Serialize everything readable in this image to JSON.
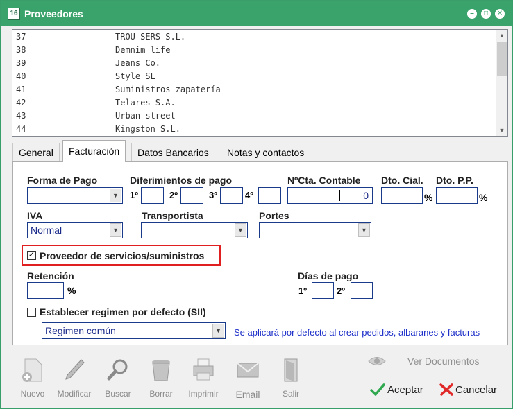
{
  "window": {
    "title": "Proveedores",
    "icon_label": "16"
  },
  "suppliers": [
    {
      "code": "37",
      "name": "TROU-SERS S.L."
    },
    {
      "code": "38",
      "name": "Demnim life"
    },
    {
      "code": "39",
      "name": "Jeans Co."
    },
    {
      "code": "40",
      "name": "Style SL"
    },
    {
      "code": "41",
      "name": "Suministros zapatería"
    },
    {
      "code": "42",
      "name": "Telares S.A."
    },
    {
      "code": "43",
      "name": "Urban street"
    },
    {
      "code": "44",
      "name": "Kingston S.L."
    }
  ],
  "tabs": [
    {
      "label": "General",
      "active": false
    },
    {
      "label": "Facturación",
      "active": true
    },
    {
      "label": "Datos Bancarios",
      "active": false
    },
    {
      "label": "Notas y contactos",
      "active": false
    }
  ],
  "billing": {
    "forma_pago": {
      "label": "Forma de Pago",
      "value": ""
    },
    "diferimientos": {
      "label": "Diferimientos de pago",
      "ordinals": [
        "1º",
        "2º",
        "3º",
        "4º"
      ]
    },
    "cta_contable": {
      "label": "NºCta. Contable",
      "value": "0"
    },
    "dto_cial": {
      "label": "Dto. Cial.",
      "suffix": "%"
    },
    "dto_pp": {
      "label": "Dto. P.P.",
      "suffix": "%"
    },
    "iva": {
      "label": "IVA",
      "value": "Normal"
    },
    "transportista": {
      "label": "Transportista",
      "value": ""
    },
    "portes": {
      "label": "Portes",
      "value": ""
    },
    "proveedor_servicios": {
      "label": "Proveedor de servicios/suministros",
      "checked": true
    },
    "retencion": {
      "label": "Retención",
      "suffix": "%"
    },
    "dias_pago": {
      "label": "Días de pago",
      "ordinals": [
        "1º",
        "2º"
      ]
    },
    "regimen": {
      "label": "Establecer regimen por defecto (SII)",
      "checked": false,
      "value": "Regimen común",
      "hint": "Se aplicará por defecto al crear pedidos, albaranes y facturas"
    }
  },
  "toolbar": {
    "nuevo": "Nuevo",
    "modificar": "Modificar",
    "buscar": "Buscar",
    "borrar": "Borrar",
    "imprimir": "Imprimir",
    "email": "Email",
    "salir": "Salir"
  },
  "actions": {
    "ver_documentos": "Ver Documentos",
    "aceptar": "Aceptar",
    "cancelar": "Cancelar"
  },
  "colors": {
    "title_bar": "#3aa36c",
    "accent_blue": "#1a3a8a",
    "hint_blue": "#1d2fc9",
    "highlight_red": "#e02020"
  }
}
